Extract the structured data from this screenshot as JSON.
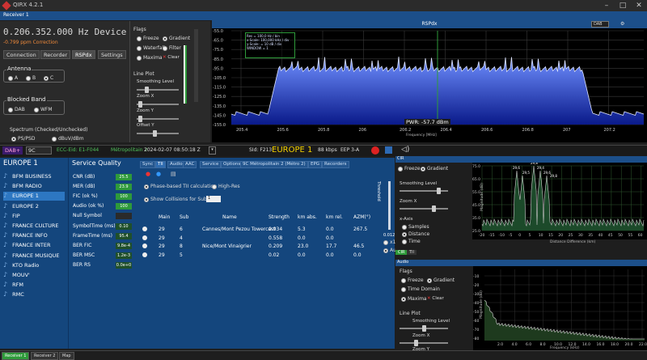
{
  "window": {
    "title": "QIRX 4.2.1",
    "receiver_bar": "Receiver 1"
  },
  "device": {
    "frequency": "0.206.352.000 Hz Device",
    "ppm": "-0.799 ppm Correction",
    "tabs": [
      "Connection",
      "Recorder",
      "RSPdx",
      "Settings"
    ],
    "antenna_label": "Antenna",
    "antenna_options": [
      "A",
      "B",
      "C"
    ],
    "blocked_band_label": "Blocked Band",
    "blocked_band_options": [
      "DAB",
      "WFM"
    ],
    "spectrum_label": "Spectrum (Checked/Unchecked)",
    "spectrum_options": [
      "PS/PSD",
      "dBuV/dBm"
    ]
  },
  "flags": {
    "title": "Flags",
    "items": [
      "Freeze",
      "Gradient",
      "Waterfall",
      "Filter",
      "Maxima",
      "Clear"
    ],
    "line_plot": "Line Plot",
    "sliders": [
      "Smoothing Level",
      "Zoom X",
      "Zoom Y",
      "Offset Y"
    ]
  },
  "rspdx": {
    "title": "RSPdx",
    "mode": "DAB",
    "info_lines": [
      "Res = 100,0 Hz / bin",
      "x-Scale: 100,000 kHz / div",
      "y-Scale: = 10 dB / div",
      "WINDOW = 1"
    ],
    "pwr": "PWR: -57.7 dBm",
    "x_ticks": [
      "205.4",
      "205.6",
      "205.8",
      "206",
      "206.2",
      "206.4",
      "206.6",
      "206.8",
      "207",
      "207.2"
    ],
    "y_ticks": [
      "-55.0",
      "-65.0",
      "-75.0",
      "-85.0",
      "-95.0",
      "-105.0",
      "-115.0",
      "-125.0",
      "-135.0",
      "-145.0",
      "-155.0"
    ],
    "xlabel": "Frequency [MHz]"
  },
  "dab": {
    "mode": "DAB+",
    "channel": "9C",
    "ecc": "ECC-Eid: E1-F044",
    "ensemble": "Métropolitain 2",
    "datetime": "2024-02-07  08:50:18 Z",
    "sid": "SId: F213",
    "station": "EUROPE 1",
    "bitrate": "88 kbps",
    "eep": "EEP 3-A"
  },
  "stations": {
    "header": "EUROPE 1",
    "items": [
      "BFM BUSINESS",
      "BFM RADIO",
      "EUROPE 1",
      "EUROPE 2",
      "FIP",
      "FRANCE CULTURE",
      "FRANCE INFO",
      "FRANCE INTER",
      "FRANCE MUSIQUE",
      "KTO Radio",
      "MOUV'",
      "RFM",
      "RMC"
    ],
    "selected": 2
  },
  "quality": {
    "header": "Service Quality",
    "rows": [
      {
        "label": "CNR (dB)",
        "value": "25.5"
      },
      {
        "label": "MER (dB)",
        "value": "23.9"
      },
      {
        "label": "FIC (ok %)",
        "value": "100"
      },
      {
        "label": "Audio (ok %)",
        "value": "100"
      },
      {
        "label": "Null Symbol",
        "value": ""
      },
      {
        "label": "SymbolTime (ms)",
        "value": "0.10"
      },
      {
        "label": "FrameTime (ms)",
        "value": "95.4"
      },
      {
        "label": "BER FIC",
        "value": "9.8e-4"
      },
      {
        "label": "BER MSC",
        "value": "1.2e-3"
      },
      {
        "label": "BER RS",
        "value": "0.0e+0"
      }
    ]
  },
  "tii": {
    "tabs": [
      "Sync",
      "TII",
      "Audio",
      "AAC",
      "Service",
      "Options",
      "9C Métropolitain 2 (Métro 2)",
      "EPG",
      "Recorders"
    ],
    "phase_label": "Phase-based TII calculation",
    "highres_label": "High-Res",
    "collisions_label": "Show Collisions for Sub Id",
    "collisions_value": "1",
    "threshold_label": "Threshold",
    "threshold_value": "0.012",
    "x10_label": "x10",
    "auto_label": "Auto",
    "columns": [
      "Main",
      "Sub",
      "Name",
      "Strength",
      "km abs.",
      "km rel.",
      "AZM(°)"
    ],
    "rows": [
      [
        "29",
        "6",
        "Cannes/Mont Pezou Towercast",
        "0.934",
        "5.3",
        "0.0",
        "267.5"
      ],
      [
        "29",
        "4",
        "",
        "0.558",
        "0.0",
        "0.0",
        ""
      ],
      [
        "29",
        "8",
        "Nice/Mont Vinaigrier",
        "0.209",
        "23.0",
        "17.7",
        "46.5"
      ],
      [
        "29",
        "5",
        "",
        "0.02",
        "0.0",
        "0.0",
        "0.0"
      ]
    ]
  },
  "tii_plot": {
    "head": "CIR",
    "flags": [
      "Freeze",
      "Gradient"
    ],
    "zoom_label": "Zoom X",
    "smoothing_label": "Smoothing Level",
    "xaxis_label": "x-Axis",
    "xaxis_options": [
      "Samples",
      "Distance",
      "Time"
    ],
    "ylabel": "Magnitude (dB)",
    "xlabel": "Distance Difference (km)",
    "x_ticks": [
      "-20",
      "-15",
      "-10",
      "-5",
      "0",
      "5",
      "10",
      "15",
      "20",
      "25",
      "30",
      "35",
      "40",
      "45",
      "50",
      "55",
      "60"
    ],
    "y_ticks": [
      "75.0",
      "65.0",
      "55.0",
      "45.0",
      "35.0",
      "25.0"
    ],
    "peak_labels": [
      "29,6",
      "29,8",
      "29,4",
      "29,5",
      "29,6",
      "29,8"
    ],
    "bottom_tabs": [
      "CIR",
      "TII"
    ]
  },
  "audio": {
    "head": "Audio",
    "flags": [
      "Freeze",
      "Gradient",
      "Time Domain",
      "Maxima",
      "Clear"
    ],
    "line_plot": "Line Plot",
    "sliders": [
      "Smoothing Level",
      "Zoom X",
      "Zoom Y"
    ],
    "ylabel": "Magnitude (dB)",
    "xlabel": "Frequency (kHz)",
    "x_ticks": [
      "2.0",
      "4.0",
      "6.0",
      "8.0",
      "10.0",
      "12.0",
      "14.0",
      "16.0",
      "18.0",
      "20.0",
      "22.0"
    ],
    "y_ticks": [
      "-10",
      "-20",
      "-30",
      "-40",
      "-50",
      "-60",
      "-70",
      "-80"
    ]
  },
  "bottom_tabs": [
    "Receiver 1",
    "Receiver 2",
    "Map"
  ],
  "colors": {
    "accent": "#1c4f8a",
    "panel_blue": "#14467d",
    "green": "#2e9a3a",
    "orange": "#f08a3a",
    "station": "#f5d200"
  }
}
